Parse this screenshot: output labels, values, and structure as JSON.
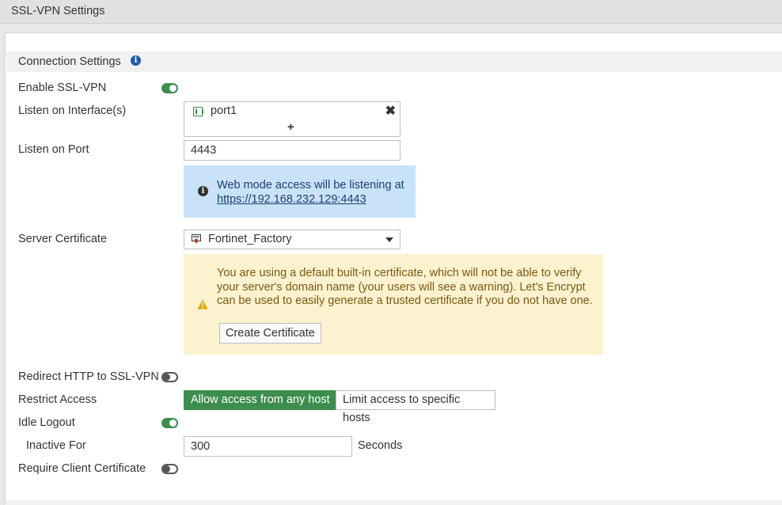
{
  "page": {
    "title": "SSL-VPN Settings"
  },
  "section": {
    "title": "Connection Settings"
  },
  "fields": {
    "enable_ssl_vpn": {
      "label": "Enable SSL-VPN",
      "state": "on"
    },
    "listen_interfaces": {
      "label": "Listen on Interface(s)",
      "items": [
        "port1"
      ],
      "add_symbol": "+",
      "remove_symbol": "✖"
    },
    "listen_port": {
      "label": "Listen on Port",
      "value": "4443"
    },
    "web_mode_info": {
      "text": "Web mode access will be listening at",
      "link": "https://192.168.232.129:4443"
    },
    "server_certificate": {
      "label": "Server Certificate",
      "value": "Fortinet_Factory"
    },
    "cert_warning": {
      "text": "You are using a default built-in certificate, which will not be able to verify your server's domain name (your users will see a warning). Let's Encrypt can be used to easily generate a trusted certificate if you do not have one.",
      "button": "Create Certificate"
    },
    "redirect_http": {
      "label": "Redirect HTTP to SSL-VPN",
      "state": "off"
    },
    "restrict_access": {
      "label": "Restrict Access",
      "options": [
        "Allow access from any host",
        "Limit access to specific hosts"
      ],
      "selected": "Allow access from any host"
    },
    "idle_logout": {
      "label": "Idle Logout",
      "state": "on"
    },
    "inactive_for": {
      "label": "Inactive For",
      "value": "300",
      "unit": "Seconds"
    },
    "require_client_cert": {
      "label": "Require Client Certificate",
      "state": "off"
    }
  },
  "colors": {
    "accent_green": "#3d8d4e",
    "info_blue_bg": "#c9e2f8",
    "warning_bg": "#fcf2d0"
  }
}
